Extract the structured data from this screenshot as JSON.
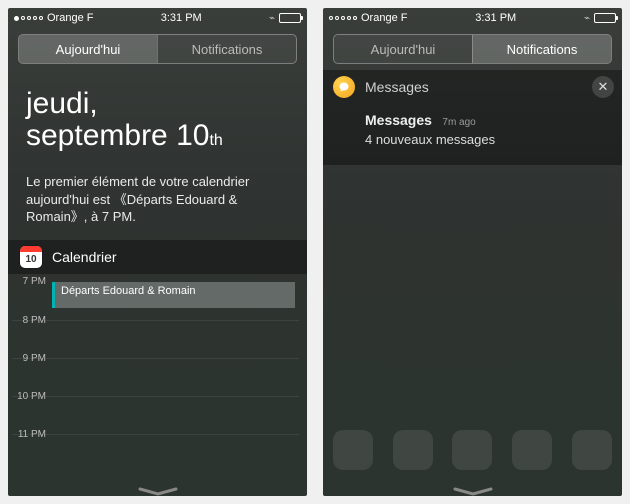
{
  "left": {
    "status": {
      "carrier": "Orange F",
      "time": "3:31 PM"
    },
    "tabs": {
      "today": "Aujourd'hui",
      "notifications": "Notifications",
      "active": "today"
    },
    "today": {
      "weekday": "jeudi,",
      "date_main": "septembre 10",
      "date_ord": "th",
      "summary": "Le premier élément de votre calendrier aujourd'hui est 《Départs Edouard & Romain》, à 7 PM."
    },
    "calendar": {
      "title": "Calendrier",
      "icon_day": "10",
      "hours": [
        "7 PM",
        "8 PM",
        "9 PM",
        "10 PM",
        "11 PM"
      ],
      "event": {
        "title": "Départs Edouard & Romain",
        "start_label": "7 PM"
      }
    }
  },
  "right": {
    "status": {
      "carrier": "Orange F",
      "time": "3:31 PM"
    },
    "tabs": {
      "today": "Aujourd'hui",
      "notifications": "Notifications",
      "active": "notifications"
    },
    "group": {
      "app": "Messages",
      "item": {
        "title": "Messages",
        "time": "7m ago",
        "body": "4 nouveaux messages"
      }
    }
  }
}
